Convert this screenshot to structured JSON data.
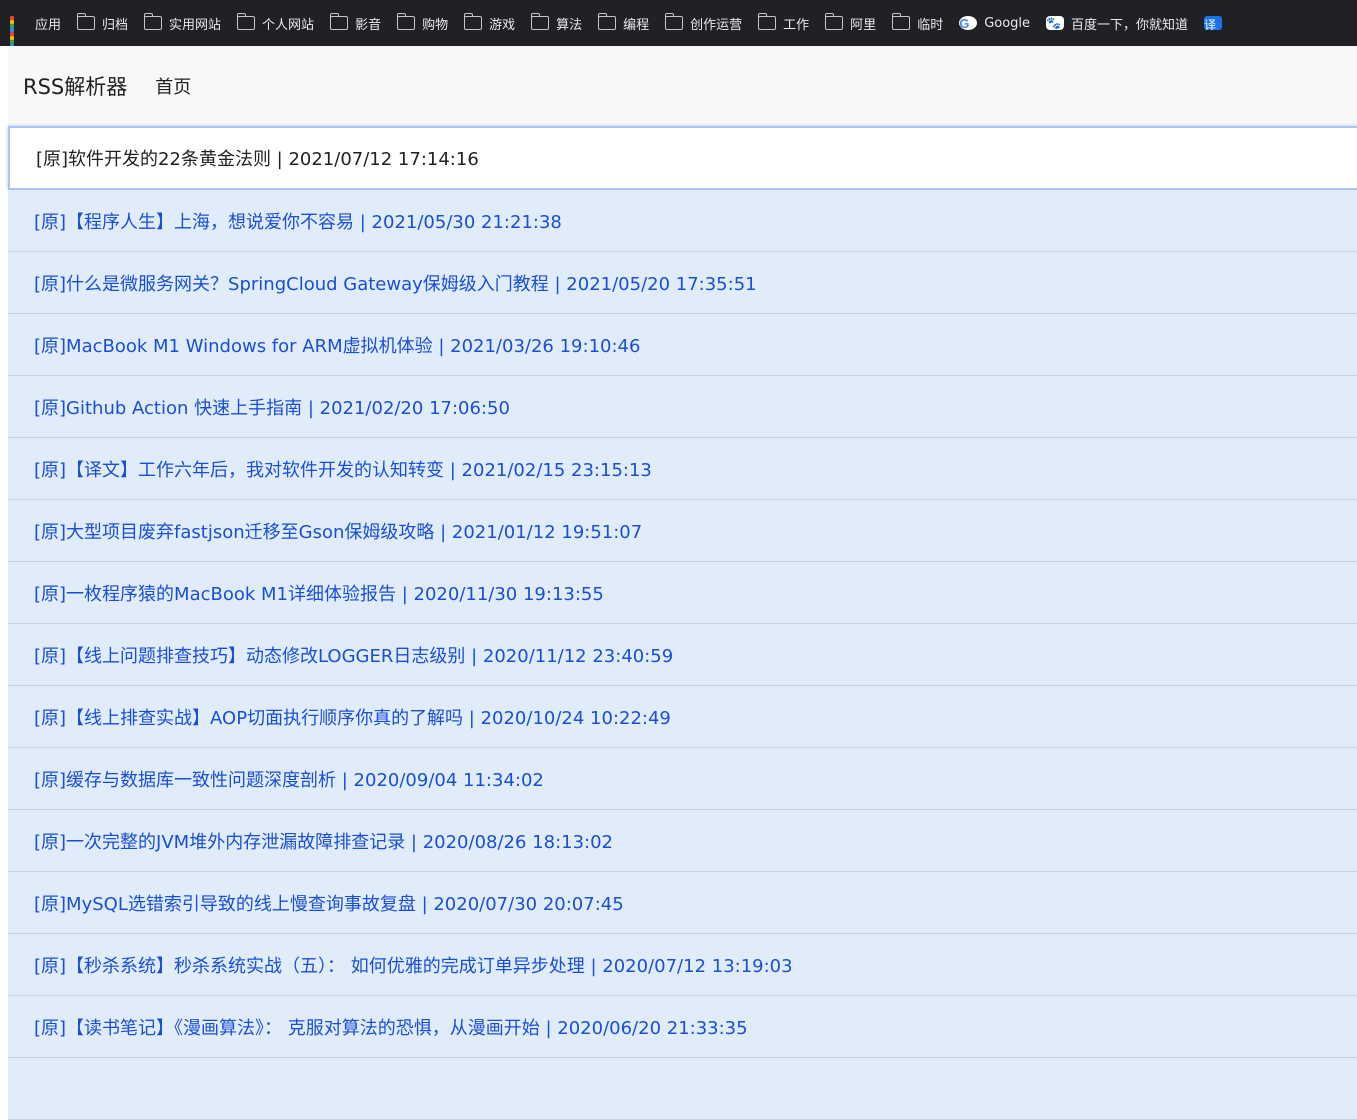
{
  "bookmarks": [
    {
      "label": "应用",
      "icon": "apps-icon"
    },
    {
      "label": "归档",
      "icon": "folder-icon"
    },
    {
      "label": "实用网站",
      "icon": "folder-icon"
    },
    {
      "label": "个人网站",
      "icon": "folder-icon"
    },
    {
      "label": "影音",
      "icon": "folder-icon"
    },
    {
      "label": "购物",
      "icon": "folder-icon"
    },
    {
      "label": "游戏",
      "icon": "folder-icon"
    },
    {
      "label": "算法",
      "icon": "folder-icon"
    },
    {
      "label": "编程",
      "icon": "folder-icon"
    },
    {
      "label": "创作运营",
      "icon": "folder-icon"
    },
    {
      "label": "工作",
      "icon": "folder-icon"
    },
    {
      "label": "阿里",
      "icon": "folder-icon"
    },
    {
      "label": "临时",
      "icon": "folder-icon"
    },
    {
      "label": "Google",
      "icon": "google-icon"
    },
    {
      "label": "百度一下，你就知道",
      "icon": "baidu-icon"
    },
    {
      "label": "",
      "icon": "translate-icon"
    }
  ],
  "colors": {
    "bookmarks_bg": "#202124",
    "navbar_bg": "#f8f8f8",
    "item_bg": "#e1ecfb",
    "item_text": "#1a4fd4",
    "active_border": "#a9c6f3"
  },
  "navbar": {
    "brand": "RSS解析器",
    "home_link": "首页"
  },
  "articles": [
    "[原]软件开发的22条黄金法则 | 2021/07/12 17:14:16",
    "[原]【程序人生】上海，想说爱你不容易 | 2021/05/30 21:21:38",
    "[原]什么是微服务网关？SpringCloud Gateway保姆级入门教程 | 2021/05/20 17:35:51",
    "[原]MacBook M1 Windows for ARM虚拟机体验 | 2021/03/26 19:10:46",
    "[原]Github Action 快速上手指南 | 2021/02/20 17:06:50",
    "[原]【译文】工作六年后，我对软件开发的认知转变 | 2021/02/15 23:15:13",
    "[原]大型项目废弃fastjson迁移至Gson保姆级攻略 | 2021/01/12 19:51:07",
    "[原]一枚程序猿的MacBook M1详细体验报告 | 2020/11/30 19:13:55",
    "[原]【线上问题排查技巧】动态修改LOGGER日志级别 | 2020/11/12 23:40:59",
    "[原]【线上排查实战】AOP切面执行顺序你真的了解吗 | 2020/10/24 10:22:49",
    "[原]缓存与数据库一致性问题深度剖析 | 2020/09/04 11:34:02",
    "[原]一次完整的JVM堆外内存泄漏故障排查记录 | 2020/08/26 18:13:02",
    "[原]MySQL选错索引导致的线上慢查询事故复盘 | 2020/07/30 20:07:45",
    "[原]【秒杀系统】秒杀系统实战（五）： 如何优雅的完成订单异步处理 | 2020/07/12 13:19:03",
    "[原]【读书笔记】《漫画算法》： 克服对算法的恐惧，从漫画开始 | 2020/06/20 21:33:35",
    ""
  ],
  "active_index": 0
}
